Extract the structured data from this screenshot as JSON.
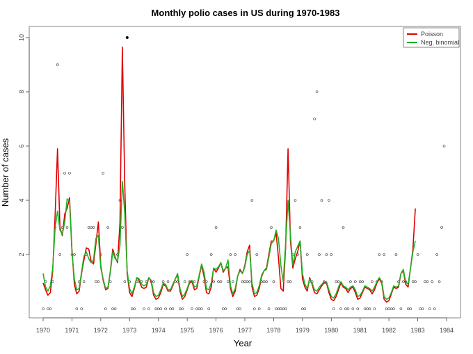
{
  "chart_data": {
    "type": "line",
    "title": "Monthly polio cases in US during 1970-1983",
    "xlabel": "Year",
    "ylabel": "Number of cases",
    "x_start": 1970,
    "x_step": 0.08333,
    "xlim": [
      1970,
      1984
    ],
    "ylim": [
      0,
      10
    ],
    "xticks": [
      "1970",
      "1971",
      "1972",
      "1973",
      "1974",
      "1975",
      "1976",
      "1977",
      "1978",
      "1979",
      "1980",
      "1981",
      "1982",
      "1983",
      "1984"
    ],
    "yticks": [
      "2",
      "4",
      "6",
      "8",
      "10"
    ],
    "grid": false,
    "legend_position": "top-right",
    "observed": [
      0,
      1,
      0,
      0,
      1,
      3,
      9,
      2,
      3,
      5,
      3,
      5,
      2,
      2,
      0,
      1,
      0,
      1,
      2,
      3,
      3,
      3,
      1,
      1,
      2,
      5,
      0,
      3,
      1,
      0,
      0,
      2,
      4,
      3,
      1,
      10,
      1,
      0,
      0,
      1,
      1,
      1,
      0,
      1,
      0,
      1,
      1,
      0,
      0,
      0,
      1,
      0,
      1,
      0,
      0,
      1,
      1,
      0,
      0,
      1,
      2,
      1,
      0,
      1,
      0,
      0,
      0,
      1,
      1,
      0,
      2,
      1,
      3,
      1,
      1,
      0,
      0,
      1,
      2,
      1,
      2,
      0,
      0,
      1,
      1,
      1,
      1,
      4,
      0,
      2,
      0,
      1,
      1,
      1,
      0,
      3,
      1,
      0,
      0,
      0,
      0,
      0,
      1,
      1,
      2,
      4,
      2,
      3,
      0,
      0,
      2,
      1,
      1,
      7,
      8,
      2,
      4,
      1,
      2,
      4,
      2,
      0,
      1,
      1,
      0,
      3,
      0,
      0,
      1,
      0,
      1,
      0,
      1,
      1,
      0,
      0,
      0,
      1,
      0,
      1,
      2,
      1,
      2,
      0,
      0,
      0,
      0,
      2,
      1,
      0,
      1,
      1,
      0,
      0,
      1,
      1,
      2,
      0,
      0,
      1,
      1,
      0,
      1,
      0,
      2,
      1,
      3,
      6
    ],
    "series": [
      {
        "name": "Poisson",
        "color": "#e00000",
        "values": [
          0.95,
          0.7,
          0.5,
          0.6,
          1.4,
          3.5,
          5.9,
          3.0,
          2.7,
          3.5,
          3.7,
          4.1,
          2.2,
          0.9,
          0.55,
          0.65,
          1.3,
          1.8,
          2.25,
          2.2,
          1.75,
          1.65,
          2.4,
          3.2,
          1.6,
          1.05,
          0.7,
          0.75,
          1.4,
          2.2,
          1.9,
          1.7,
          3.2,
          9.65,
          4.5,
          1.3,
          0.6,
          0.45,
          0.75,
          1.15,
          1.05,
          0.8,
          0.75,
          0.8,
          1.15,
          1.0,
          0.5,
          0.35,
          0.4,
          0.6,
          0.9,
          0.85,
          0.65,
          0.65,
          0.85,
          1.1,
          1.25,
          0.65,
          0.35,
          0.45,
          0.7,
          0.95,
          1.0,
          0.7,
          0.75,
          1.2,
          1.6,
          1.2,
          0.6,
          0.55,
          0.8,
          1.5,
          1.35,
          1.5,
          1.7,
          1.35,
          1.5,
          1.55,
          0.75,
          0.45,
          0.65,
          1.2,
          1.45,
          1.3,
          1.6,
          2.1,
          2.35,
          0.8,
          0.45,
          0.5,
          0.75,
          1.2,
          1.4,
          1.5,
          2.0,
          2.5,
          2.5,
          2.8,
          1.9,
          0.75,
          0.65,
          2.3,
          5.9,
          2.5,
          1.5,
          1.85,
          2.1,
          2.5,
          1.1,
          0.8,
          0.65,
          1.15,
          0.9,
          0.6,
          0.55,
          0.7,
          0.85,
          0.95,
          0.95,
          0.6,
          0.35,
          0.3,
          0.45,
          0.7,
          0.95,
          0.8,
          0.75,
          0.6,
          0.75,
          0.8,
          0.6,
          0.35,
          0.4,
          0.6,
          0.8,
          0.75,
          0.7,
          0.55,
          0.7,
          0.95,
          1.1,
          0.95,
          0.35,
          0.25,
          0.3,
          0.55,
          0.8,
          0.75,
          0.8,
          1.3,
          1.4,
          0.9,
          0.8,
          1.5,
          2.2,
          3.7
        ]
      },
      {
        "name": "Neg. binomial",
        "color": "#22b022",
        "values": [
          1.3,
          0.8,
          0.65,
          0.85,
          1.5,
          3.0,
          3.6,
          2.9,
          2.75,
          3.2,
          4.05,
          3.95,
          2.1,
          1.1,
          0.7,
          0.75,
          1.35,
          1.95,
          2.1,
          1.85,
          1.7,
          1.8,
          2.6,
          2.7,
          1.5,
          1.1,
          0.75,
          0.8,
          1.35,
          2.1,
          1.85,
          1.75,
          2.35,
          4.7,
          3.5,
          1.4,
          0.75,
          0.55,
          0.8,
          1.15,
          1.1,
          0.9,
          0.85,
          0.9,
          1.15,
          1.05,
          0.6,
          0.45,
          0.5,
          0.7,
          0.95,
          0.9,
          0.7,
          0.7,
          0.9,
          1.1,
          1.3,
          0.75,
          0.45,
          0.55,
          0.75,
          1.0,
          1.05,
          0.8,
          0.85,
          1.25,
          1.65,
          1.35,
          0.75,
          0.7,
          0.95,
          1.5,
          1.45,
          1.55,
          1.7,
          1.4,
          1.5,
          1.8,
          0.85,
          0.55,
          0.75,
          1.2,
          1.4,
          1.3,
          1.55,
          2.0,
          2.15,
          0.95,
          0.55,
          0.6,
          0.85,
          1.25,
          1.4,
          1.45,
          1.9,
          2.4,
          2.5,
          2.9,
          2.6,
          1.6,
          1.0,
          2.45,
          4.0,
          2.7,
          1.6,
          2.1,
          2.3,
          2.5,
          1.3,
          0.9,
          0.75,
          1.1,
          0.95,
          0.7,
          0.65,
          0.8,
          0.9,
          1.0,
          1.0,
          0.7,
          0.45,
          0.4,
          0.55,
          0.8,
          1.0,
          0.85,
          0.8,
          0.7,
          0.8,
          0.85,
          0.7,
          0.45,
          0.5,
          0.65,
          0.85,
          0.8,
          0.75,
          0.65,
          0.8,
          1.0,
          1.15,
          1.0,
          0.45,
          0.35,
          0.4,
          0.6,
          0.85,
          0.8,
          0.85,
          1.3,
          1.45,
          1.0,
          0.9,
          1.5,
          2.1,
          2.5
        ]
      }
    ]
  }
}
